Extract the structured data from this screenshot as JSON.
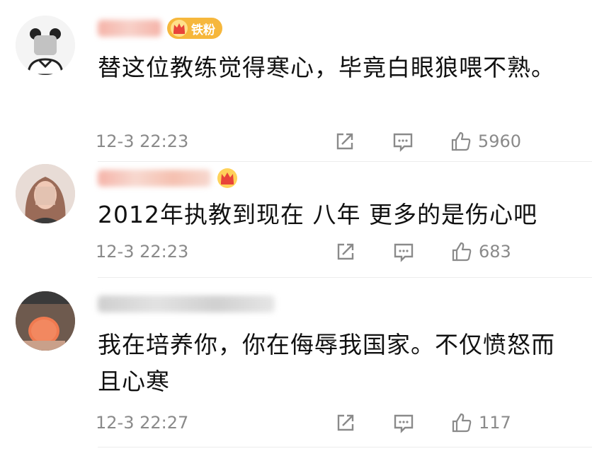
{
  "comments": [
    {
      "badge": "铁粉",
      "text": "替这位教练觉得寒心，毕竟白眼狼喂不熟。",
      "time": "12-3 22:23",
      "likes": "5960"
    },
    {
      "text": "2012年执教到现在 八年 更多的是伤心吧",
      "time": "12-3 22:23",
      "likes": "683"
    },
    {
      "text": "我在培养你，你在侮辱我国家。不仅愤怒而且心寒",
      "time": "12-3 22:27",
      "likes": "117"
    }
  ],
  "icons": {
    "share": "share-icon",
    "comment": "comment-icon",
    "like": "thumbs-up-icon",
    "crown": "crown-icon"
  },
  "colors": {
    "badge_bg": "#f6b73c",
    "crown_gold": "#f5a623",
    "crown_red": "#e8443a",
    "meta_gray": "#8a8a8a"
  }
}
